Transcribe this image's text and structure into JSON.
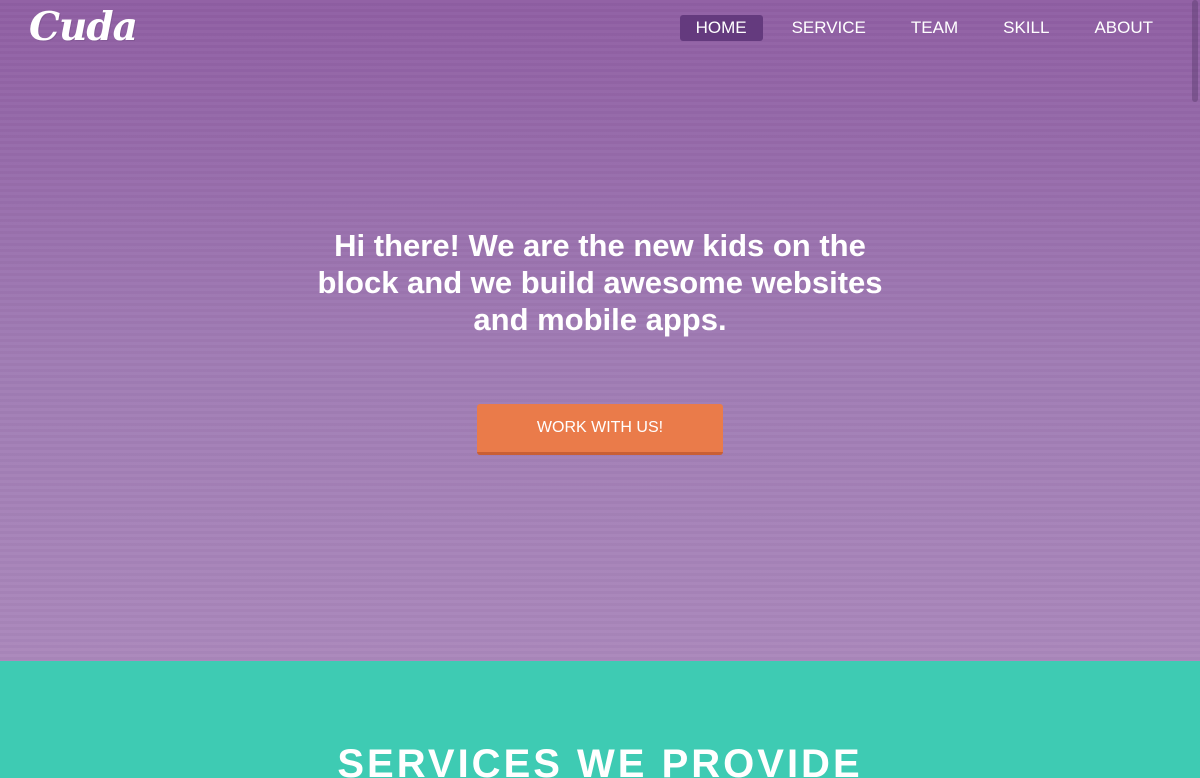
{
  "header": {
    "logo_text": "Cuda",
    "nav": [
      {
        "label": "HOME",
        "active": true
      },
      {
        "label": "SERVICE",
        "active": false
      },
      {
        "label": "TEAM",
        "active": false
      },
      {
        "label": "SKILL",
        "active": false
      },
      {
        "label": "ABOUT",
        "active": false
      }
    ]
  },
  "hero": {
    "heading": "Hi there! We are the new kids on the block and we build awesome websites and mobile apps.",
    "cta_label": "WORK WITH US!"
  },
  "services": {
    "title": "SERVICES WE PROVIDE"
  },
  "colors": {
    "hero_top": "#8f5ea3",
    "hero_bottom": "#aa87bb",
    "nav_active_bg": "#643a7e",
    "cta_bg": "#ea7b4a",
    "services_bg": "#3ecbb3",
    "text": "#ffffff"
  }
}
